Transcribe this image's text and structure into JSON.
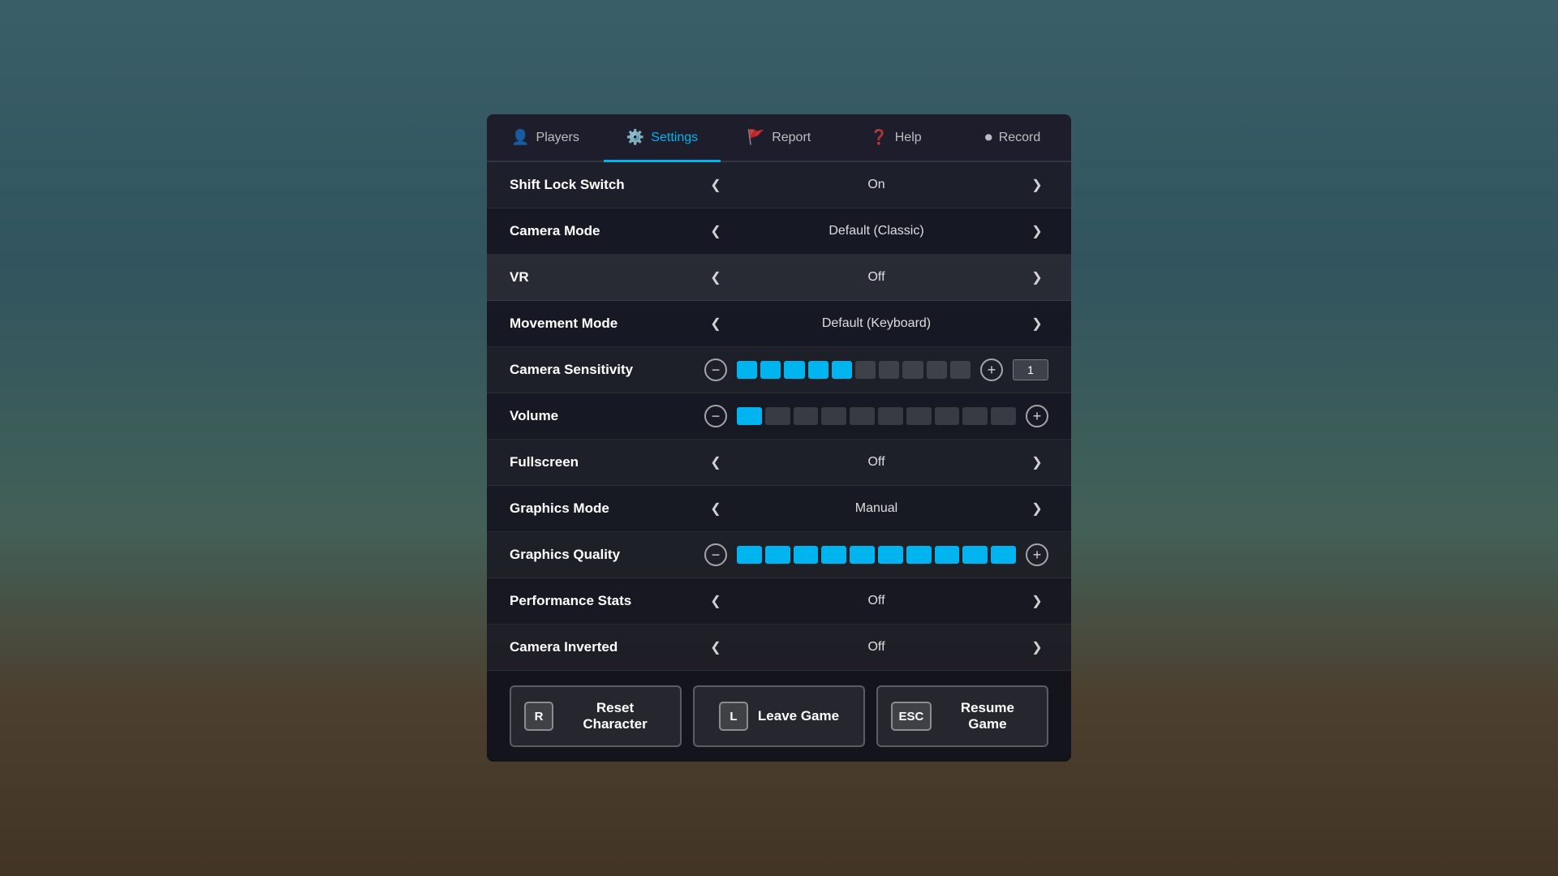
{
  "background": {
    "overlay_opacity": "0.45"
  },
  "tabs": [
    {
      "id": "players",
      "label": "Players",
      "icon": "👤",
      "active": false
    },
    {
      "id": "settings",
      "label": "Settings",
      "icon": "⚙️",
      "active": true
    },
    {
      "id": "report",
      "label": "Report",
      "icon": "🚩",
      "active": false
    },
    {
      "id": "help",
      "label": "Help",
      "icon": "❓",
      "active": false
    },
    {
      "id": "record",
      "label": "Record",
      "icon": "⏺",
      "active": false
    }
  ],
  "settings": [
    {
      "id": "shift-lock-switch",
      "label": "Shift Lock Switch",
      "type": "toggle",
      "value": "On"
    },
    {
      "id": "camera-mode",
      "label": "Camera Mode",
      "type": "toggle",
      "value": "Default (Classic)"
    },
    {
      "id": "vr",
      "label": "VR",
      "type": "toggle",
      "value": "Off",
      "highlighted": true
    },
    {
      "id": "movement-mode",
      "label": "Movement Mode",
      "type": "toggle",
      "value": "Default (Keyboard)"
    },
    {
      "id": "camera-sensitivity",
      "label": "Camera Sensitivity",
      "type": "slider",
      "filled": 5,
      "total": 10,
      "numInput": "1"
    },
    {
      "id": "volume",
      "label": "Volume",
      "type": "slider",
      "filled": 1,
      "total": 10,
      "numInput": null
    },
    {
      "id": "fullscreen",
      "label": "Fullscreen",
      "type": "toggle",
      "value": "Off"
    },
    {
      "id": "graphics-mode",
      "label": "Graphics Mode",
      "type": "toggle",
      "value": "Manual"
    },
    {
      "id": "graphics-quality",
      "label": "Graphics Quality",
      "type": "slider",
      "filled": 10,
      "total": 10,
      "numInput": null
    },
    {
      "id": "performance-stats",
      "label": "Performance Stats",
      "type": "toggle",
      "value": "Off"
    },
    {
      "id": "camera-inverted",
      "label": "Camera Inverted",
      "type": "toggle",
      "value": "Off"
    }
  ],
  "buttons": [
    {
      "id": "reset-character",
      "key": "R",
      "label": "Reset Character"
    },
    {
      "id": "leave-game",
      "key": "L",
      "label": "Leave Game"
    },
    {
      "id": "resume-game",
      "key": "ESC",
      "label": "Resume Game"
    }
  ]
}
